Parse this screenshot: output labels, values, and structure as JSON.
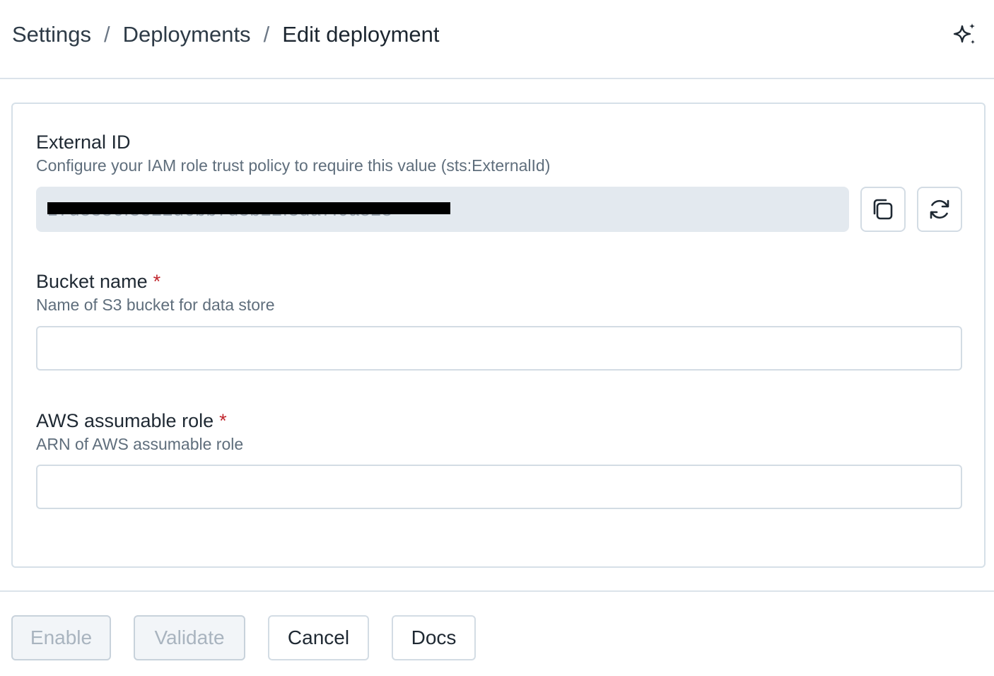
{
  "breadcrumb": {
    "items": [
      "Settings",
      "Deployments",
      "Edit deployment"
    ],
    "separator": "/"
  },
  "header": {
    "assistant_icon": "sparkle-icon"
  },
  "external_id": {
    "label": "External ID",
    "help": "Configure your IAM role trust policy to require this value (sts:ExternalId)",
    "value": "17d3386f3322d6bb7d3b22f3da7f0a828",
    "copy_icon": "copy-icon",
    "regenerate_icon": "refresh-icon"
  },
  "bucket_name": {
    "label": "Bucket name",
    "required_mark": "*",
    "help": "Name of S3 bucket for data store",
    "value": ""
  },
  "aws_role": {
    "label": "AWS assumable role",
    "required_mark": "*",
    "help": "ARN of AWS assumable role",
    "value": ""
  },
  "actions": {
    "enable": "Enable",
    "validate": "Validate",
    "cancel": "Cancel",
    "docs": "Docs"
  },
  "colors": {
    "required": "#c0262d",
    "readonly_bg": "#e3e9ef",
    "border": "#d3dce4",
    "disabled_text": "#a9b4bf"
  }
}
